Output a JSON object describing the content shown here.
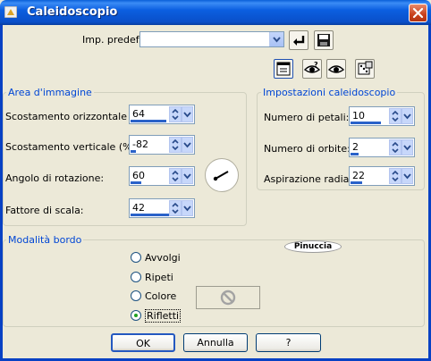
{
  "window": {
    "title": "Caleidoscopio",
    "close_label": "✕"
  },
  "presets": {
    "label": "Imp. predef.:",
    "value": ""
  },
  "image_area": {
    "title": "Area d'immagine",
    "fields": [
      {
        "label": "Scostamento orizzontale (%):",
        "value": "64",
        "level": 0.82
      },
      {
        "label": "Scostamento verticale (%):",
        "value": "-82",
        "level": 0.09
      },
      {
        "label": "Angolo di rotazione:",
        "value": "60",
        "level": 0.17
      },
      {
        "label": "Fattore di scala:",
        "value": "42",
        "level": 0.73
      }
    ]
  },
  "kaleido_settings": {
    "title": "Impostazioni caleidoscopio",
    "fields": [
      {
        "label": "Numero di petali:",
        "value": "10",
        "level": 0.77
      },
      {
        "label": "Numero di orbite:",
        "value": "2",
        "level": 0.2
      },
      {
        "label": "Aspirazione radiale:",
        "value": "22",
        "level": 0.3
      }
    ]
  },
  "edge_mode": {
    "title": "Modalità bordo",
    "options": [
      {
        "label": "Avvolgi",
        "selected": false
      },
      {
        "label": "Ripeti",
        "selected": false
      },
      {
        "label": "Colore",
        "selected": false
      },
      {
        "label": "Rifletti",
        "selected": true
      }
    ]
  },
  "buttons": {
    "ok": "OK",
    "cancel": "Annulla",
    "help": "?"
  },
  "watermark": "Pinuccia",
  "colors": {
    "title_bar": "#0a5fd8",
    "group_title": "#0046d5",
    "background": "#ece9d8",
    "accent_bar": "#2a62c9",
    "selected_radio": "#21a121"
  },
  "icons": [
    "dialog-app-icon",
    "close-icon",
    "reset-arrow-icon",
    "save-disk-icon",
    "layout-icon",
    "eye-question-icon",
    "eye-icon",
    "dice-icon",
    "no-symbol-icon"
  ]
}
